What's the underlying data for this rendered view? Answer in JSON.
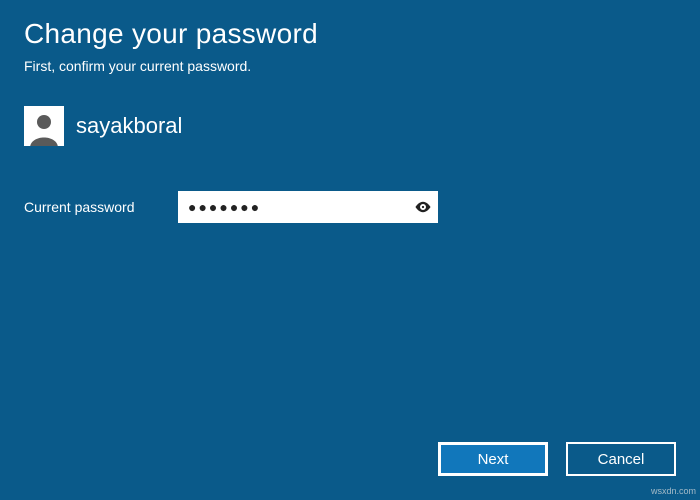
{
  "colors": {
    "background": "#0a5a8a",
    "primary_button": "#1177bb",
    "text": "#ffffff"
  },
  "header": {
    "title": "Change your password",
    "subtitle": "First, confirm your current password."
  },
  "user": {
    "name": "sayakboral"
  },
  "form": {
    "current_label": "Current password",
    "current_value": "●●●●●●●"
  },
  "buttons": {
    "next": "Next",
    "cancel": "Cancel"
  },
  "watermark": "wsxdn.com"
}
